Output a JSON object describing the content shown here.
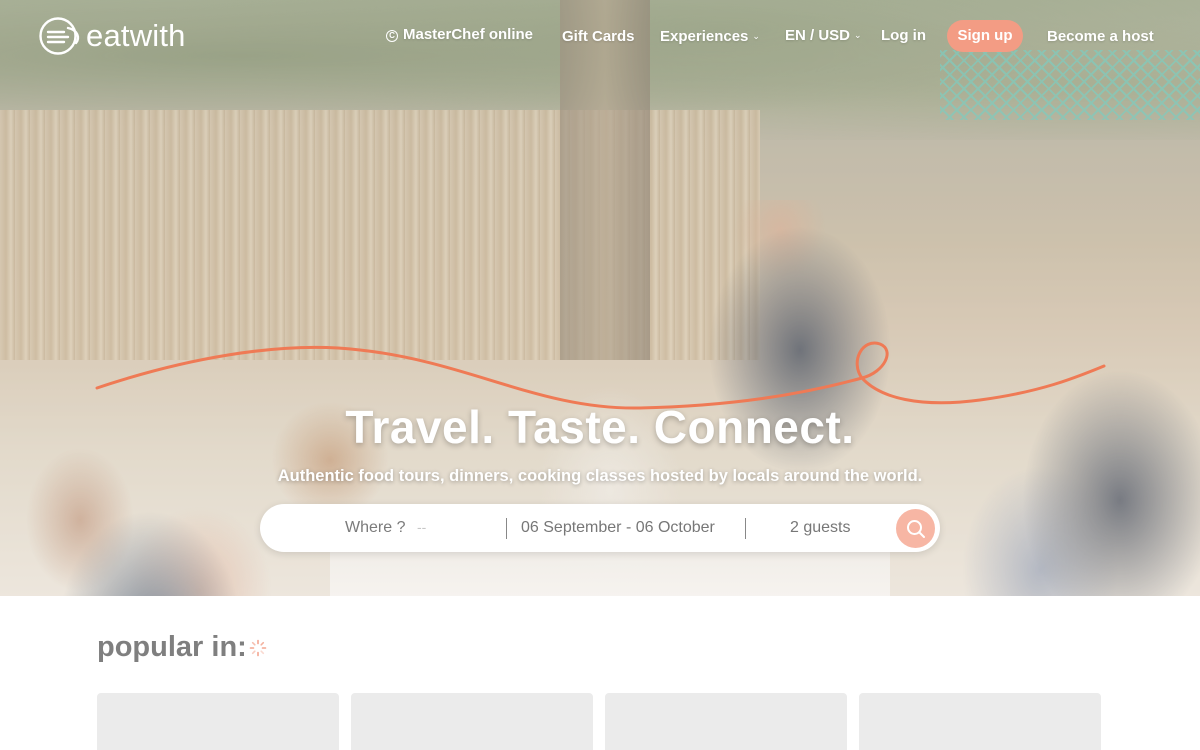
{
  "brand": {
    "name": "eatwith"
  },
  "nav": {
    "masterchef": "MasterChef online",
    "gift_cards": "Gift Cards",
    "experiences": "Experiences",
    "lang_currency": "EN / USD",
    "login": "Log in",
    "signup": "Sign up",
    "become_host": "Become a host"
  },
  "hero": {
    "headline": "Travel. Taste. Connect.",
    "subline": "Authentic food tours, dinners, cooking classes hosted by locals around the world."
  },
  "search": {
    "where_label": "Where ?",
    "where_placeholder": "--",
    "dates": "06 September - 06 October",
    "guests": "2 guests"
  },
  "popular": {
    "title": "popular in:"
  },
  "colors": {
    "accent": "#f39c84",
    "wave": "#ef7a55",
    "search_button": "#f7b6a4"
  },
  "icons": [
    "eatwith-logo-icon",
    "masterchef-icon",
    "chevron-down-icon",
    "search-icon",
    "loading-spinner-icon"
  ]
}
